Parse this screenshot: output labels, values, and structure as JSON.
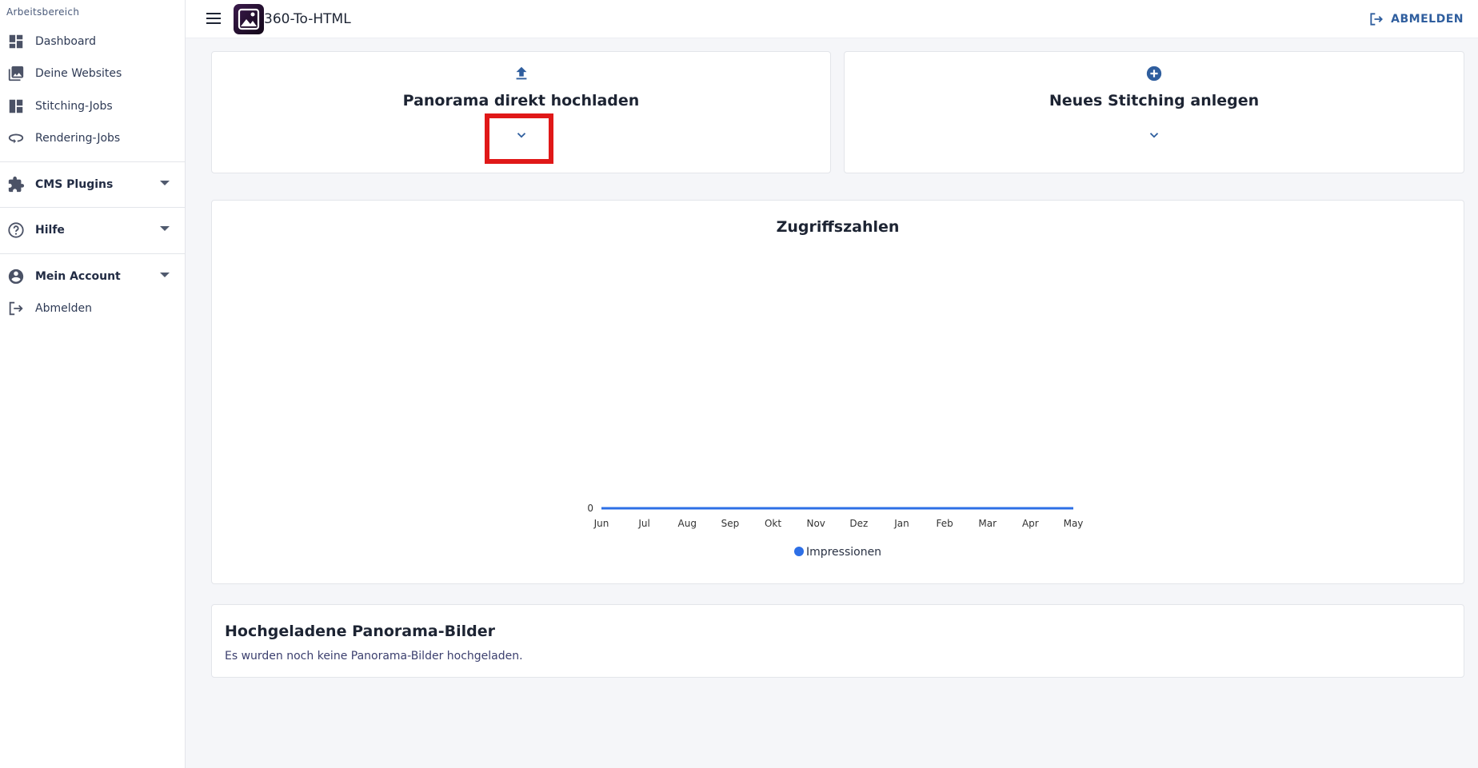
{
  "sidebar": {
    "workspace_label": "Arbeitsbereich",
    "items": [
      {
        "label": "Dashboard",
        "icon": "dashboard-icon"
      },
      {
        "label": "Deine Websites",
        "icon": "photo-library-icon"
      },
      {
        "label": "Stitching-Jobs",
        "icon": "grid-layout-icon"
      },
      {
        "label": "Rendering-Jobs",
        "icon": "rotate-360-icon"
      },
      {
        "label": "CMS Plugins",
        "icon": "puzzle-icon",
        "expandable": true
      },
      {
        "label": "Hilfe",
        "icon": "help-circle-icon",
        "expandable": true
      },
      {
        "label": "Mein Account",
        "icon": "account-circle-icon",
        "expandable": true
      },
      {
        "label": "Abmelden",
        "icon": "logout-icon"
      }
    ]
  },
  "topbar": {
    "app_title": "360-To-HTML",
    "logout_label": "ABMELDEN"
  },
  "cards": {
    "upload_title": "Panorama direkt hochladen",
    "stitching_title": "Neues Stitching anlegen"
  },
  "chart_data": {
    "type": "line",
    "title": "Zugriffszahlen",
    "categories": [
      "Jun",
      "Jul",
      "Aug",
      "Sep",
      "Okt",
      "Nov",
      "Dez",
      "Jan",
      "Feb",
      "Mar",
      "Apr",
      "May"
    ],
    "series": [
      {
        "name": "Impressionen",
        "values": [
          0,
          0,
          0,
          0,
          0,
          0,
          0,
          0,
          0,
          0,
          0,
          0
        ],
        "color": "#2d6fe6"
      }
    ],
    "yticks": [
      "0"
    ],
    "ylim": [
      0,
      0
    ],
    "legend": "bottom"
  },
  "uploads": {
    "title": "Hochgeladene Panorama-Bilder",
    "empty_text": "Es wurden noch keine Panorama-Bilder hochgeladen."
  },
  "colors": {
    "accent": "#2f5e9e",
    "series": "#2d6fe6",
    "highlight": "#e01818"
  }
}
